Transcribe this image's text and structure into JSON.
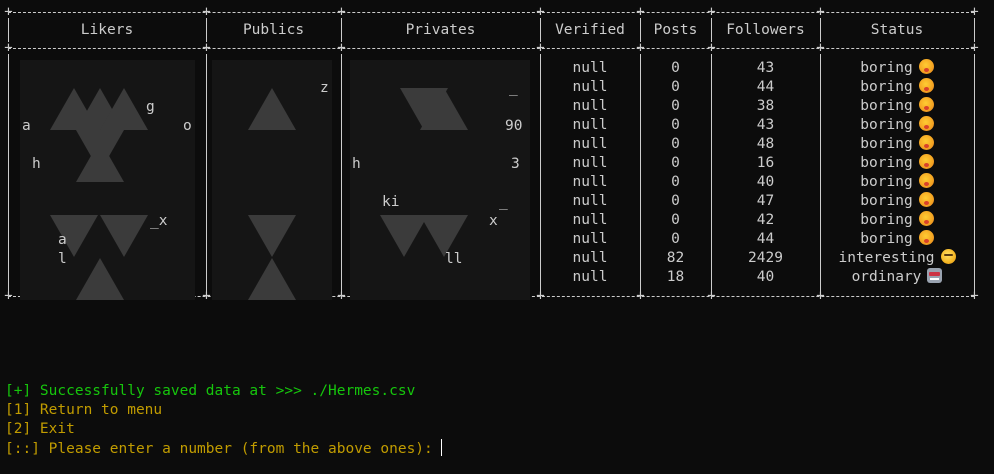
{
  "table": {
    "columns": [
      "Likers",
      "Publics",
      "Privates",
      "Verified",
      "Posts",
      "Followers",
      "Status"
    ],
    "rows": [
      {
        "verified": "null",
        "posts": "0",
        "followers": "43",
        "status": "boring",
        "status_icon": "pouting-face-icon"
      },
      {
        "verified": "null",
        "posts": "0",
        "followers": "44",
        "status": "boring",
        "status_icon": "pouting-face-icon"
      },
      {
        "verified": "null",
        "posts": "0",
        "followers": "38",
        "status": "boring",
        "status_icon": "pouting-face-icon"
      },
      {
        "verified": "null",
        "posts": "0",
        "followers": "43",
        "status": "boring",
        "status_icon": "pouting-face-icon"
      },
      {
        "verified": "null",
        "posts": "0",
        "followers": "48",
        "status": "boring",
        "status_icon": "pouting-face-icon"
      },
      {
        "verified": "null",
        "posts": "0",
        "followers": "16",
        "status": "boring",
        "status_icon": "pouting-face-icon"
      },
      {
        "verified": "null",
        "posts": "0",
        "followers": "40",
        "status": "boring",
        "status_icon": "pouting-face-icon"
      },
      {
        "verified": "null",
        "posts": "0",
        "followers": "47",
        "status": "boring",
        "status_icon": "pouting-face-icon"
      },
      {
        "verified": "null",
        "posts": "0",
        "followers": "42",
        "status": "boring",
        "status_icon": "pouting-face-icon"
      },
      {
        "verified": "null",
        "posts": "0",
        "followers": "44",
        "status": "boring",
        "status_icon": "pouting-face-icon"
      },
      {
        "verified": "null",
        "posts": "82",
        "followers": "2429",
        "status": "interesting",
        "status_icon": "thinking-face-icon"
      },
      {
        "verified": "null",
        "posts": "18",
        "followers": "40",
        "status": "ordinary",
        "status_icon": "robot-face-icon"
      }
    ],
    "visible_fragments": {
      "likers": [
        "g",
        "a",
        "o",
        "h",
        "_x",
        "a",
        "l"
      ],
      "publics": [
        "z"
      ],
      "privates": [
        "_",
        "90",
        "3",
        "ki",
        "_",
        "x",
        "ll",
        "h"
      ]
    }
  },
  "output": {
    "success": "[+] Successfully saved data at >>> ./Hermes.csv",
    "option1": "[1] Return to menu",
    "option2": "[2] Exit",
    "prompt": "[::] Please enter a number (from the above ones):"
  },
  "colors": {
    "background": "#0c0c0c",
    "text": "#cccccc",
    "success": "#16c60c",
    "menu": "#c19c00"
  }
}
